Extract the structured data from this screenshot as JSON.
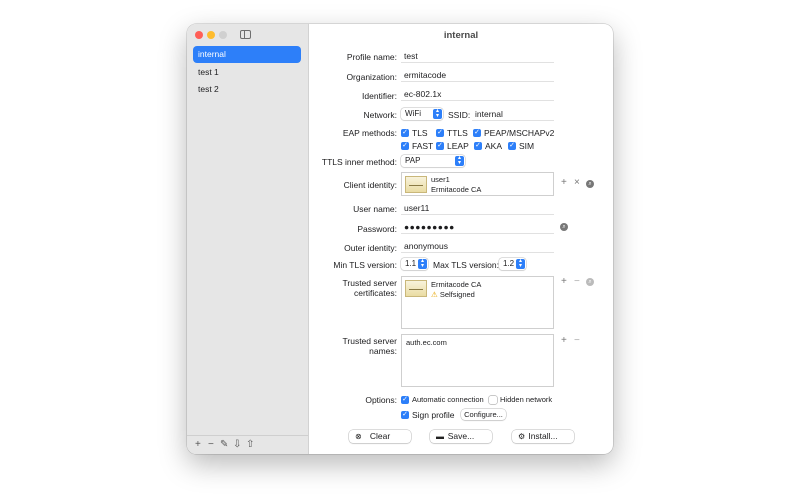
{
  "window": {
    "title": "internal"
  },
  "sidebar": {
    "items": [
      {
        "label": "internal",
        "selected": true
      },
      {
        "label": "test 1",
        "selected": false
      },
      {
        "label": "test 2",
        "selected": false
      }
    ],
    "footer": {
      "add": "+",
      "remove": "−",
      "edit": "✎",
      "import": "⇩",
      "export": "⇧"
    }
  },
  "form": {
    "profile_name": {
      "label": "Profile name:",
      "value": "test"
    },
    "organization": {
      "label": "Organization:",
      "value": "ermitacode"
    },
    "identifier": {
      "label": "Identifier:",
      "value": "ec-802.1x"
    },
    "network": {
      "label": "Network:",
      "value": "WiFi",
      "ssid_label": "SSID:",
      "ssid_value": "internal"
    },
    "eap": {
      "label": "EAP methods:",
      "methods": [
        {
          "label": "TLS",
          "checked": true
        },
        {
          "label": "TTLS",
          "checked": true
        },
        {
          "label": "PEAP/MSCHAPv2",
          "checked": true
        },
        {
          "label": "FAST",
          "checked": true
        },
        {
          "label": "LEAP",
          "checked": true
        },
        {
          "label": "AKA",
          "checked": true
        },
        {
          "label": "SIM",
          "checked": true
        }
      ]
    },
    "ttls_inner": {
      "label": "TTLS inner method:",
      "value": "PAP"
    },
    "client_identity": {
      "label": "Client identity:",
      "name": "user1",
      "issuer": "Ermitacode CA"
    },
    "user_name": {
      "label": "User name:",
      "value": "user11"
    },
    "password": {
      "label": "Password:",
      "value": "●●●●●●●●●"
    },
    "outer_identity": {
      "label": "Outer identity:",
      "value": "anonymous"
    },
    "tls": {
      "min_label": "Min TLS version:",
      "min_value": "1.1",
      "max_label": "Max TLS version:",
      "max_value": "1.2"
    },
    "trusted_certs": {
      "label_line1": "Trusted server",
      "label_line2": "certificates:",
      "name": "Ermitacode CA",
      "status": "Selfsigned"
    },
    "trusted_names": {
      "label_line1": "Trusted server",
      "label_line2": "names:",
      "value": "auth.ec.com"
    },
    "options": {
      "label": "Options:",
      "auto_connect": {
        "label": "Automatic connection",
        "checked": true
      },
      "hidden_network": {
        "label": "Hidden network",
        "checked": false
      },
      "sign_profile": {
        "label": "Sign profile",
        "checked": true
      },
      "configure_label": "Configure..."
    }
  },
  "buttons": {
    "clear": "Clear",
    "save": "Save...",
    "install": "Install..."
  },
  "colors": {
    "accent": "#2d7ff9",
    "sidebar_bg": "#e6e6e6",
    "close": "#ff5f57",
    "minimize": "#febc2e"
  }
}
